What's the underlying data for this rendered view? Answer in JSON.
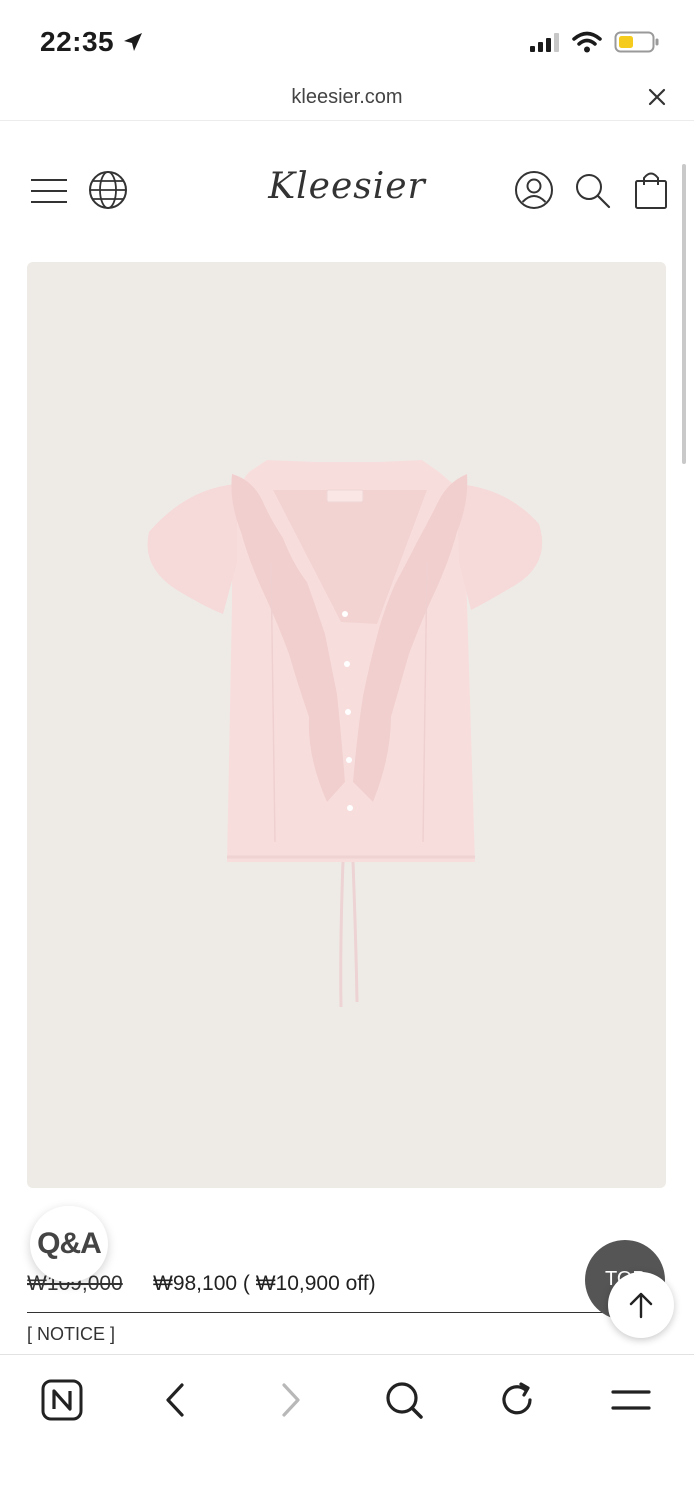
{
  "status_bar": {
    "time": "22:35"
  },
  "browser": {
    "url": "kleesier.com"
  },
  "header": {
    "logo": "Kleesier"
  },
  "price": {
    "original": "₩109,000",
    "sale": "₩98,100 ( ₩10,900 off)"
  },
  "notice": "[ NOTICE ]",
  "floating": {
    "qa_label": "Q&A",
    "top_label": "TOP"
  },
  "colors": {
    "product_bg": "#eeebe6",
    "blouse": "#f6dcdc",
    "battery": "#f5cc1d"
  },
  "icons": [
    "location-arrow-icon",
    "signal-icon",
    "wifi-icon",
    "battery-icon",
    "close-icon",
    "menu-icon",
    "globe-icon",
    "account-icon",
    "search-icon",
    "shopping-bag-icon",
    "arrow-up-icon",
    "naver-home-icon",
    "back-icon",
    "forward-icon",
    "refresh-icon"
  ]
}
